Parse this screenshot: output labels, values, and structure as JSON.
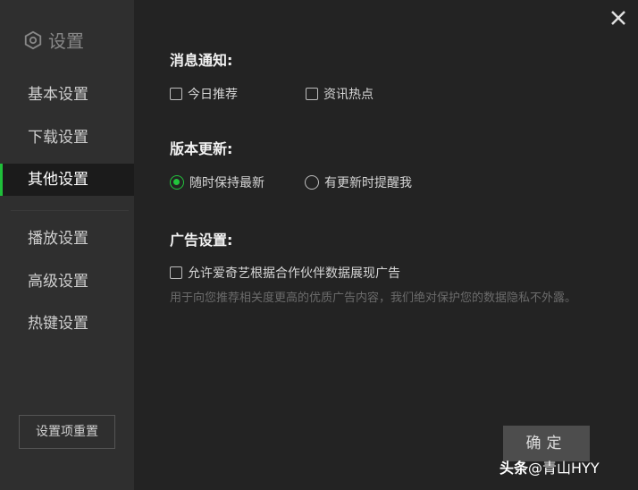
{
  "sidebar": {
    "title": "设置",
    "items": [
      {
        "label": "基本设置",
        "active": false
      },
      {
        "label": "下载设置",
        "active": false
      },
      {
        "label": "其他设置",
        "active": true
      },
      {
        "label": "播放设置",
        "active": false
      },
      {
        "label": "高级设置",
        "active": false
      },
      {
        "label": "热键设置",
        "active": false
      }
    ],
    "reset_label": "设置项重置"
  },
  "sections": {
    "notifications": {
      "title": "消息通知:",
      "options": [
        {
          "label": "今日推荐",
          "checked": false
        },
        {
          "label": "资讯热点",
          "checked": false
        }
      ]
    },
    "updates": {
      "title": "版本更新:",
      "options": [
        {
          "label": "随时保持最新",
          "selected": true
        },
        {
          "label": "有更新时提醒我",
          "selected": false
        }
      ]
    },
    "ads": {
      "title": "广告设置:",
      "option": {
        "label": "允许爱奇艺根据合作伙伴数据展现广告",
        "checked": false
      },
      "note": "用于向您推荐相关度更高的优质广告内容，我们绝对保护您的数据隐私不外露。"
    }
  },
  "confirm_label": "确定",
  "watermark": {
    "prefix": "头条",
    "handle": "@青山HYY"
  },
  "colors": {
    "accent": "#22c43c",
    "sidebar_bg": "#2f2f2f",
    "content_bg": "#232323"
  }
}
